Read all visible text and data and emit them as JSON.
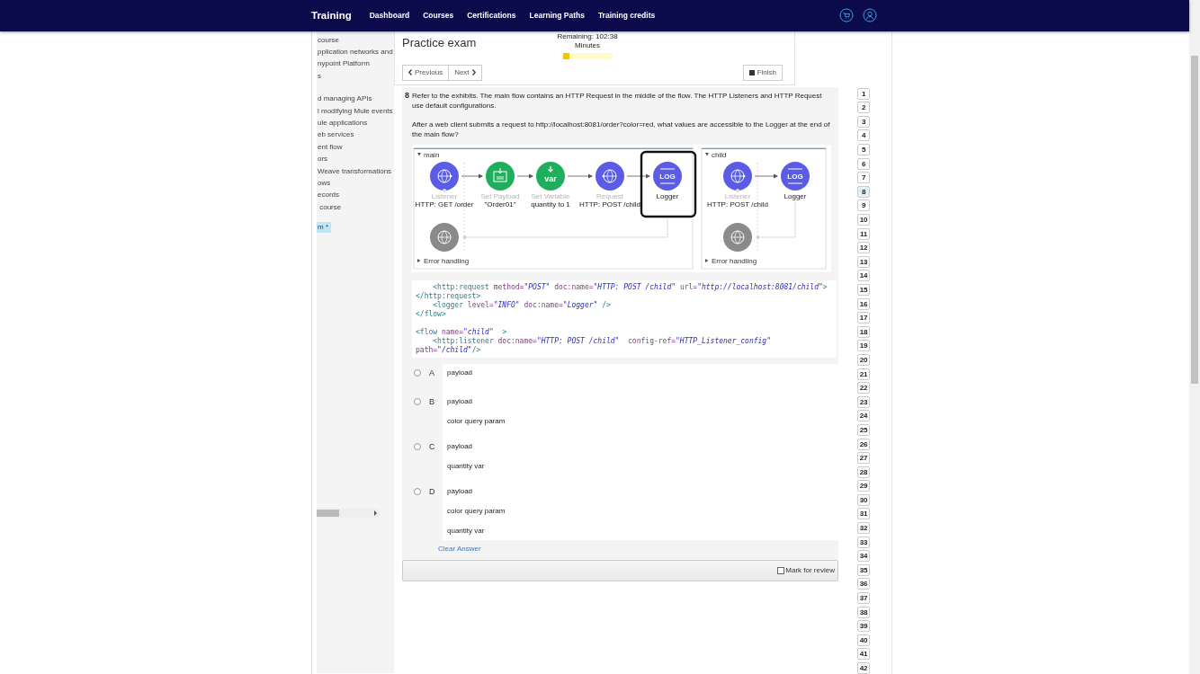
{
  "nav": {
    "brand": "Training",
    "links": [
      "Dashboard",
      "Courses",
      "Certifications",
      "Learning Paths",
      "Training credits"
    ]
  },
  "sidebar": {
    "items": [
      {
        "label": "course",
        "selected": false
      },
      {
        "label": "pplication networks and",
        "selected": false
      },
      {
        "label": "nypoint Platform",
        "selected": false
      },
      {
        "label": "s",
        "selected": false
      },
      {
        "label": "d managing APIs",
        "selected": false
      },
      {
        "label": "l modifying Mule events",
        "selected": false
      },
      {
        "label": "ule applications",
        "selected": false
      },
      {
        "label": "eb services",
        "selected": false
      },
      {
        "label": "ent flow",
        "selected": false
      },
      {
        "label": "ors",
        "selected": false
      },
      {
        "label": "Weave transformations",
        "selected": false
      },
      {
        "label": "ows",
        "selected": false
      },
      {
        "label": "ecords",
        "selected": false
      },
      {
        "label": " course",
        "selected": false
      },
      {
        "label": "m *",
        "selected": true
      }
    ]
  },
  "exam": {
    "title": "Practice exam",
    "timer": {
      "remaining": "Remaining: 102:38",
      "unit": "Minutes",
      "level": 0.13
    },
    "previous": "Previous",
    "next": "Next",
    "finish": "Finish"
  },
  "question": {
    "number": "8",
    "paragraphs": [
      "Refer to the exhibits. The main flow contains an HTTP Request in the middle of the flow. The HTTP Listeners and HTTP Request use default configurations.",
      "After a web client submits a request to http://localhost:8081/order?color=red, what values are accessible to the Logger at the end of the main flow?"
    ],
    "exhibit": {
      "flows": [
        {
          "name": "main",
          "error_label": "Error handling",
          "nodes": [
            {
              "kind": "listener",
              "label": "Listener",
              "caption": "HTTP: GET /order",
              "highlighted": false
            },
            {
              "kind": "set-payload",
              "label": "Set Payload",
              "caption": "\"Order01\"",
              "highlighted": false
            },
            {
              "kind": "set-variable",
              "label": "Set Variable",
              "caption": "quantity to 1",
              "badge": "var",
              "highlighted": false
            },
            {
              "kind": "request",
              "label": "Request",
              "caption": "HTTP: POST /child",
              "highlighted": false
            },
            {
              "kind": "logger",
              "caption": "Logger",
              "badge": "LOG",
              "highlighted": true
            }
          ]
        },
        {
          "name": "child",
          "error_label": "Error handling",
          "nodes": [
            {
              "kind": "listener",
              "label": "Listener",
              "caption": "HTTP: POST /child",
              "highlighted": false
            },
            {
              "kind": "logger",
              "caption": "Logger",
              "badge": "LOG",
              "highlighted": false
            }
          ]
        }
      ]
    },
    "code": [
      "    <http:request method=\"POST\" doc:name=\"HTTP: POST /child\" url=\"http://localhost:8081/child\"></http:request>",
      "    <logger level=\"INFO\" doc:name=\"Logger\" />",
      "</flow>",
      "<flow name=\"child\"  >",
      "    <http:listener doc:name=\"HTTP: POST /child\"  config-ref=\"HTTP_Listener_config\" path=\"/child\"/>"
    ],
    "options": [
      {
        "letter": "A",
        "selected": false,
        "lines": [
          "payload"
        ]
      },
      {
        "letter": "B",
        "selected": false,
        "lines": [
          "payload",
          "color query param"
        ]
      },
      {
        "letter": "C",
        "selected": false,
        "lines": [
          "payload",
          "quantity var"
        ]
      },
      {
        "letter": "D",
        "selected": false,
        "lines": [
          "payload",
          "color query param",
          "quantity var"
        ]
      }
    ],
    "clear": "Clear Answer",
    "mark_for_review": {
      "label": "Mark for review",
      "checked": false
    }
  },
  "question_nav": [
    {
      "label": "1",
      "selected": false
    },
    {
      "label": "2",
      "selected": false
    },
    {
      "label": "3",
      "selected": false
    },
    {
      "label": "4",
      "selected": false
    },
    {
      "label": "5",
      "selected": false
    },
    {
      "label": "6",
      "selected": false
    },
    {
      "label": "7",
      "selected": false
    },
    {
      "label": "8",
      "selected": true
    },
    {
      "label": "9",
      "selected": false
    },
    {
      "label": "10",
      "selected": false
    },
    {
      "label": "11",
      "selected": false
    },
    {
      "label": "12",
      "selected": false
    },
    {
      "label": "13",
      "selected": false
    },
    {
      "label": "14",
      "selected": false
    },
    {
      "label": "15",
      "selected": false
    },
    {
      "label": "16",
      "selected": false
    },
    {
      "label": "17",
      "selected": false
    },
    {
      "label": "18",
      "selected": false
    },
    {
      "label": "19",
      "selected": false
    },
    {
      "label": "20",
      "selected": false
    },
    {
      "label": "21",
      "selected": false
    },
    {
      "label": "22",
      "selected": false
    },
    {
      "label": "23",
      "selected": false
    },
    {
      "label": "24",
      "selected": false
    },
    {
      "label": "25",
      "selected": false
    },
    {
      "label": "26",
      "selected": false
    },
    {
      "label": "27",
      "selected": false
    },
    {
      "label": "28",
      "selected": false
    },
    {
      "label": "29",
      "selected": false
    },
    {
      "label": "30",
      "selected": false
    },
    {
      "label": "31",
      "selected": false
    },
    {
      "label": "32",
      "selected": false
    },
    {
      "label": "33",
      "selected": false
    },
    {
      "label": "34",
      "selected": false
    },
    {
      "label": "35",
      "selected": false
    },
    {
      "label": "36",
      "selected": false
    },
    {
      "label": "37",
      "selected": false
    },
    {
      "label": "38",
      "selected": false
    },
    {
      "label": "39",
      "selected": false
    },
    {
      "label": "40",
      "selected": false
    },
    {
      "label": "41",
      "selected": false
    },
    {
      "label": "42",
      "selected": false
    }
  ]
}
